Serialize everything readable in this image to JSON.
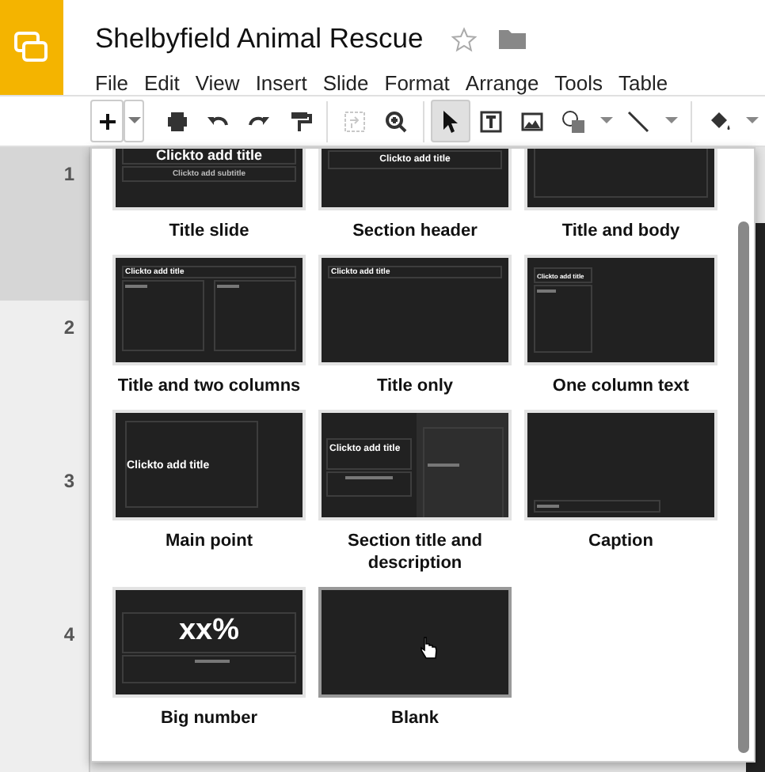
{
  "document": {
    "title": "Shelbyfield Animal Rescue",
    "starred": false
  },
  "menu": [
    "File",
    "Edit",
    "View",
    "Insert",
    "Slide",
    "Format",
    "Arrange",
    "Tools",
    "Table"
  ],
  "tools": [
    {
      "selected": false,
      "disabled": false
    },
    {
      "selected": false,
      "disabled": false
    },
    {
      "selected": false,
      "disabled": false
    },
    {
      "selected": false,
      "disabled": false
    },
    {
      "selected": false,
      "disabled": false
    },
    {
      "selected": false,
      "disabled": true
    },
    {
      "selected": false,
      "disabled": false
    },
    {
      "selected": true,
      "disabled": false
    },
    {
      "selected": false,
      "disabled": false
    },
    {
      "selected": false,
      "disabled": false
    },
    {
      "selected": false,
      "disabled": false
    },
    {
      "selected": false,
      "disabled": false
    },
    {
      "selected": false,
      "disabled": false
    }
  ],
  "slides": [
    {
      "number": "1",
      "selected": true
    },
    {
      "number": "2",
      "selected": false
    },
    {
      "number": "3",
      "selected": false
    },
    {
      "number": "4",
      "selected": false
    }
  ],
  "layouts": [
    {
      "kind": "title",
      "label": "Title slide",
      "hovered": false,
      "title_text": "Clickto add title",
      "subtitle_text": "Clickto add subtitle"
    },
    {
      "kind": "section",
      "label": "Section header",
      "hovered": false,
      "title_text": "Clickto add title"
    },
    {
      "kind": "title_body",
      "label": "Title and body",
      "hovered": false
    },
    {
      "kind": "two_columns",
      "label": "Title and two columns",
      "hovered": false,
      "title_text": "Clickto add title"
    },
    {
      "kind": "title_only",
      "label": "Title only",
      "hovered": false,
      "title_text": "Clickto add title"
    },
    {
      "kind": "one_column",
      "label": "One column text",
      "hovered": false,
      "title_text": "Clickto add title"
    },
    {
      "kind": "main_point",
      "label": "Main point",
      "hovered": false,
      "title_text": "Clickto add title"
    },
    {
      "kind": "section_desc",
      "label": "Section title and description",
      "hovered": false,
      "title_text": "Clickto add title"
    },
    {
      "kind": "caption",
      "label": "Caption",
      "hovered": false
    },
    {
      "kind": "big_number",
      "label": "Big number",
      "hovered": false,
      "title_text": "xx%"
    },
    {
      "kind": "blank",
      "label": "Blank",
      "hovered": true
    }
  ]
}
